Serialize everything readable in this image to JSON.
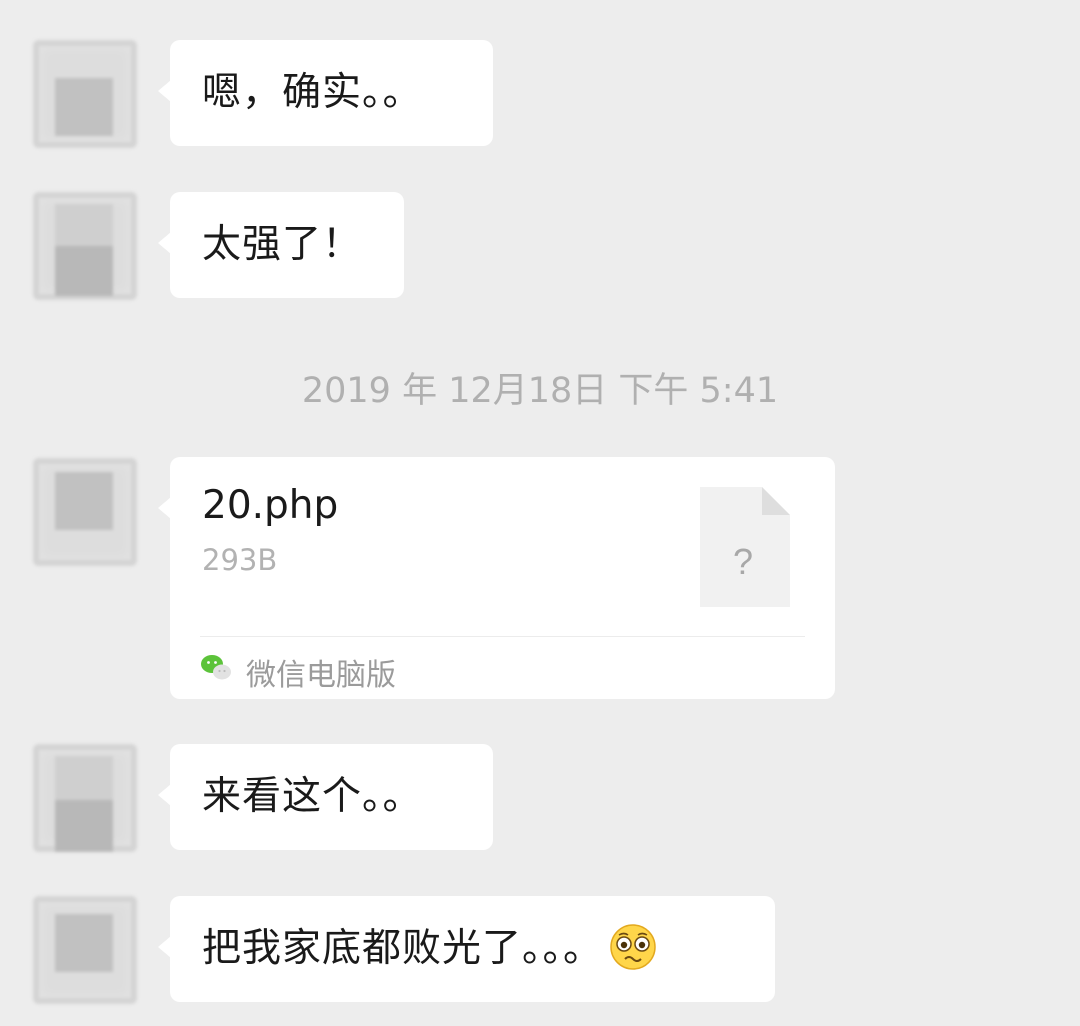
{
  "messages": [
    {
      "type": "text",
      "text": "嗯，确实。。"
    },
    {
      "type": "text",
      "text": "太强了！"
    },
    {
      "type": "file",
      "file_name": "20.php",
      "file_size": "293B",
      "file_icon_glyph": "?",
      "source": "微信电脑版",
      "source_icon": "wechat-icon"
    },
    {
      "type": "text",
      "text": "来看这个。。"
    },
    {
      "type": "text",
      "text": "把我家底都败光了。。。",
      "emoji": "woozy-face-emoji"
    }
  ],
  "timestamp": "2019 年 12月18日 下午 5:41",
  "colors": {
    "background": "#ededed",
    "bubble": "#ffffff",
    "text": "#1a1a1a",
    "timestamp": "#b0b0b0",
    "file_size": "#b2b2b2",
    "wechat_green": "#5cc33a"
  }
}
